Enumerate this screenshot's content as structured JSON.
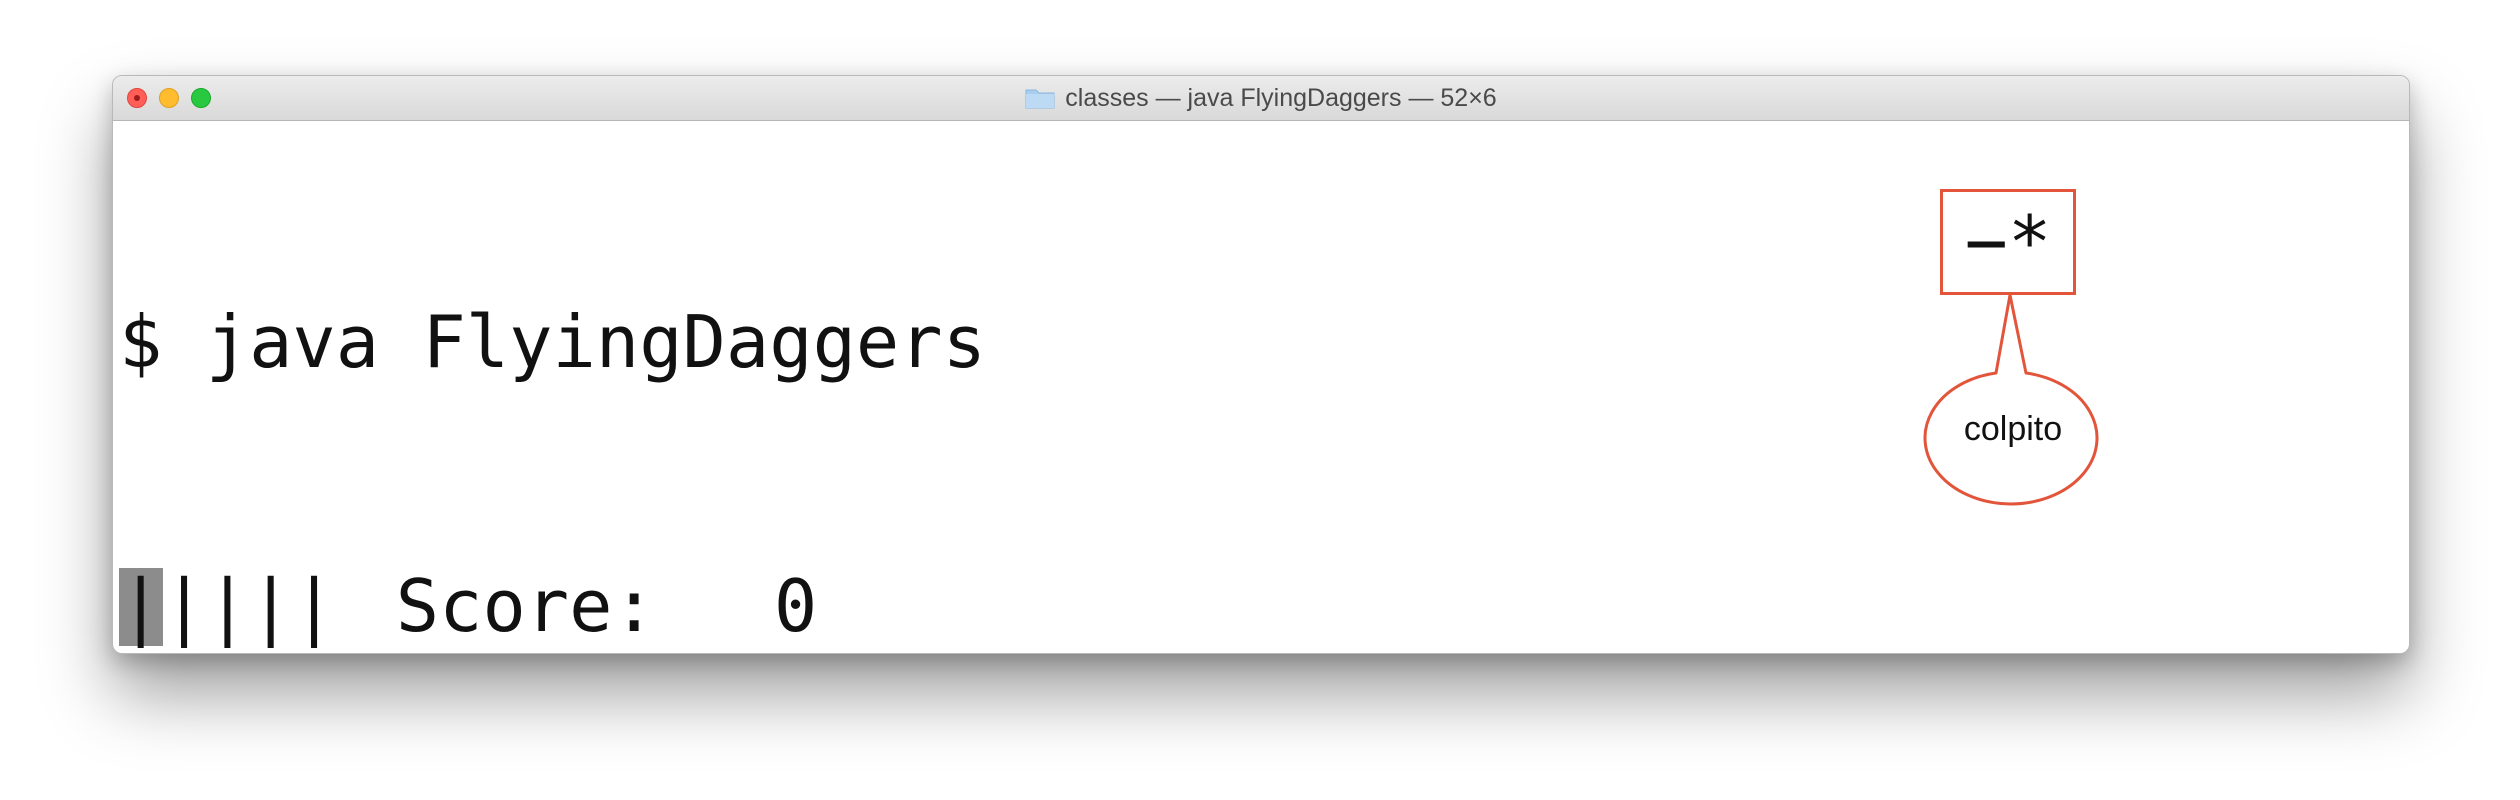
{
  "window": {
    "title": "classes — java FlyingDaggers — 52×6",
    "folder_icon": "folder-icon"
  },
  "terminal": {
    "prompt": "$",
    "command": "java FlyingDaggers",
    "lives": "|||||",
    "score_label": "Score:",
    "score_value": "0"
  },
  "game": {
    "dagger": "−*"
  },
  "annotation": {
    "label": "colpito"
  },
  "colors": {
    "close": "#ff5f57",
    "minimize": "#febc2e",
    "maximize": "#28c840",
    "annotation_outline": "#e2553b",
    "cursor": "#8c8c8c"
  }
}
